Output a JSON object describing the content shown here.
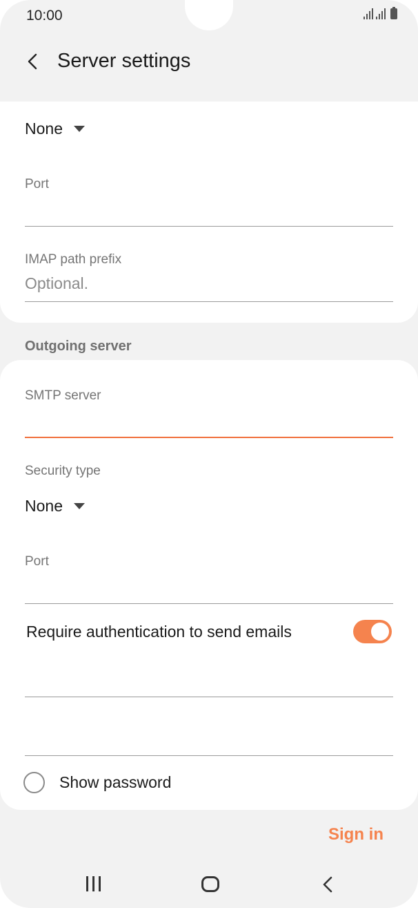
{
  "status_bar": {
    "time": "10:00"
  },
  "header": {
    "title": "Server settings"
  },
  "incoming": {
    "security_value": "None",
    "port_label": "Port",
    "imap_label": "IMAP path prefix",
    "imap_placeholder": "Optional."
  },
  "outgoing": {
    "section_title": "Outgoing server",
    "smtp_label": "SMTP server",
    "security_label": "Security type",
    "security_value": "None",
    "port_label": "Port",
    "auth_label": "Require authentication to send emails",
    "auth_enabled": true,
    "show_password_label": "Show password",
    "show_password_checked": false
  },
  "actions": {
    "sign_in": "Sign in"
  },
  "colors": {
    "accent": "#f5834e",
    "background": "#f2f2f2",
    "card": "#ffffff"
  }
}
